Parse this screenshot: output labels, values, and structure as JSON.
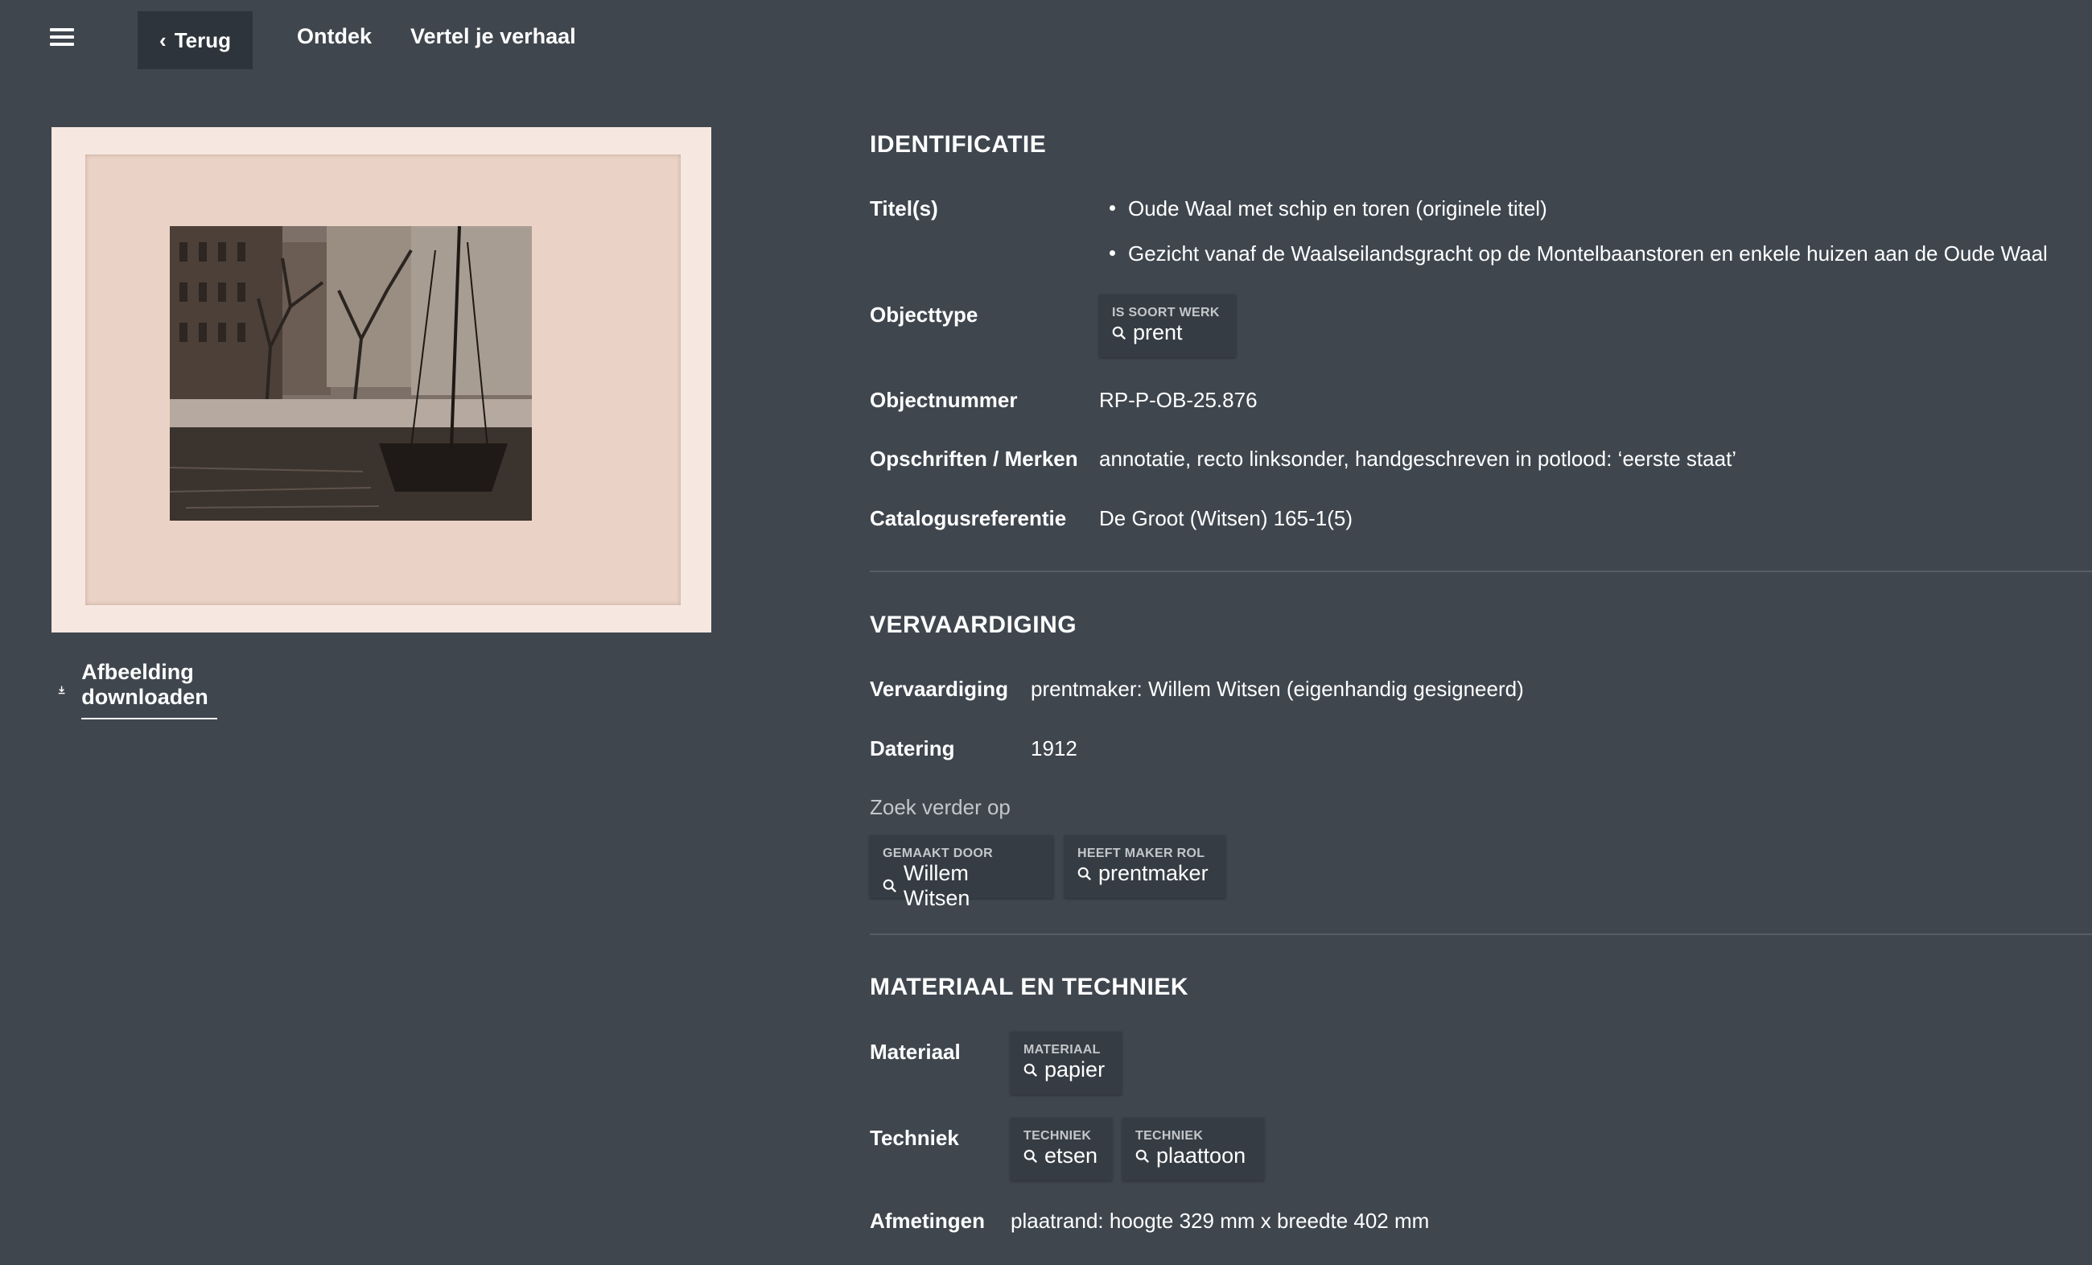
{
  "nav": {
    "back_label": "Terug",
    "links": [
      "Ontdek",
      "Vertel je verhaal"
    ]
  },
  "artwork": {
    "download_label": "Afbeelding downloaden"
  },
  "identificatie": {
    "title": "IDENTIFICATIE",
    "titles_label": "Titel(s)",
    "titles": [
      "Oude Waal met schip en toren (originele titel)",
      "Gezicht vanaf de Waalseilandsgracht op de Montelbaanstoren en enkele huizen aan de Oude Waal"
    ],
    "objecttype_label": "Objecttype",
    "objecttype_chip": {
      "category": "IS SOORT WERK",
      "value": "prent"
    },
    "objectnummer_label": "Objectnummer",
    "objectnummer": "RP-P-OB-25.876",
    "opschriften_label": "Opschriften / Merken",
    "opschriften": "annotatie, recto linksonder, handgeschreven in potlood: ‘eerste staat’",
    "catalogus_label": "Catalogusreferentie",
    "catalogus": "De Groot (Witsen) 165-1(5)"
  },
  "vervaardiging": {
    "title": "VERVAARDIGING",
    "vervaardiging_label": "Vervaardiging",
    "vervaardiging": "prentmaker: Willem Witsen (eigenhandig gesigneerd)",
    "datering_label": "Datering",
    "datering": "1912",
    "zoek_label": "Zoek verder op",
    "chips": [
      {
        "category": "GEMAAKT DOOR",
        "value": "Willem Witsen"
      },
      {
        "category": "HEEFT MAKER ROL",
        "value": "prentmaker"
      }
    ]
  },
  "materiaal": {
    "title": "MATERIAAL EN TECHNIEK",
    "materiaal_label": "Materiaal",
    "materiaal_chip": {
      "category": "MATERIAAL",
      "value": "papier"
    },
    "techniek_label": "Techniek",
    "techniek_chips": [
      {
        "category": "TECHNIEK",
        "value": "etsen"
      },
      {
        "category": "TECHNIEK",
        "value": "plaattoon"
      }
    ],
    "afmetingen_label": "Afmetingen",
    "afmetingen": "plaatrand: hoogte 329 mm x breedte 402 mm"
  },
  "colors": {
    "background": "#3f464e",
    "chip_background": "#363c43",
    "back_button": "#2e343b",
    "muted_text": "#c3c7cc"
  }
}
